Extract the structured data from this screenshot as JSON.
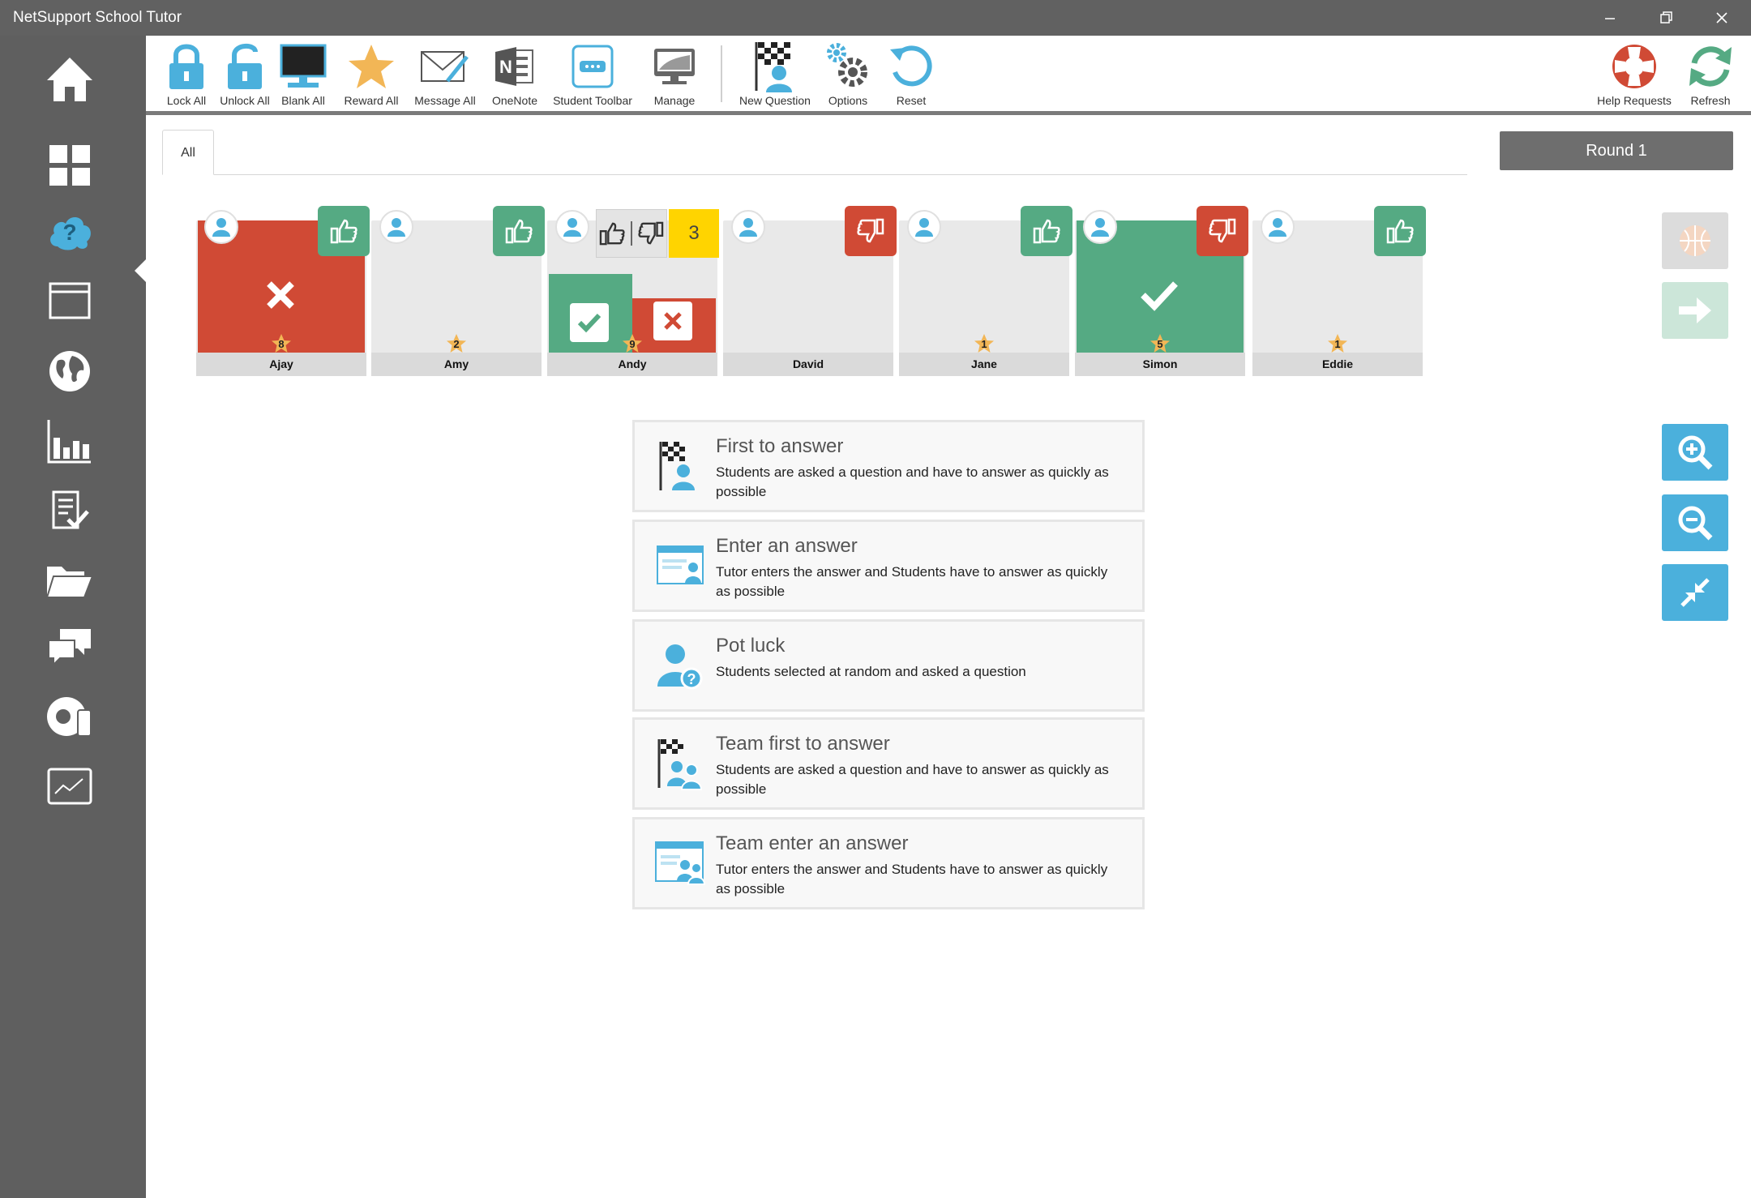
{
  "window": {
    "title": "NetSupport School Tutor"
  },
  "toolbar": {
    "items": [
      {
        "label": "Lock All",
        "icon": "lock-icon"
      },
      {
        "label": "Unlock All",
        "icon": "unlock-icon"
      },
      {
        "label": "Blank All",
        "icon": "monitor-icon"
      },
      {
        "label": "Reward All",
        "icon": "star-icon"
      },
      {
        "label": "Message All",
        "icon": "envelope-icon"
      },
      {
        "label": "OneNote",
        "icon": "onenote-icon"
      },
      {
        "label": "Student Toolbar",
        "icon": "toolbar-icon"
      },
      {
        "label": "Manage",
        "icon": "manage-icon"
      },
      {
        "label": "New Question",
        "icon": "checkered-flag-icon"
      },
      {
        "label": "Options",
        "icon": "gears-icon"
      },
      {
        "label": "Reset",
        "icon": "reset-icon"
      },
      {
        "label": "Help Requests",
        "icon": "lifebuoy-icon"
      },
      {
        "label": "Refresh",
        "icon": "refresh-icon"
      }
    ]
  },
  "tabs": [
    {
      "label": "All"
    }
  ],
  "round": {
    "label": "Round 1"
  },
  "students": [
    {
      "name": "Ajay",
      "score": "8",
      "state": "wrong",
      "vote": "up"
    },
    {
      "name": "Amy",
      "score": "2",
      "state": "none",
      "vote": "up"
    },
    {
      "name": "Andy",
      "score": "9",
      "state": "split",
      "vote": "both",
      "count": "3"
    },
    {
      "name": "David",
      "score": "",
      "state": "none",
      "vote": "down"
    },
    {
      "name": "Jane",
      "score": "1",
      "state": "none",
      "vote": "up"
    },
    {
      "name": "Simon",
      "score": "5",
      "state": "correct",
      "vote": "down"
    },
    {
      "name": "Eddie",
      "score": "1",
      "state": "none",
      "vote": "up"
    }
  ],
  "modes": [
    {
      "title": "First to answer",
      "desc": "Students are asked a question and have to answer as quickly as possible"
    },
    {
      "title": "Enter an answer",
      "desc": "Tutor enters the answer and Students have to answer as quickly as possible"
    },
    {
      "title": "Pot luck",
      "desc": "Students selected at random and asked a question"
    },
    {
      "title": "Team first to answer",
      "desc": "Students are asked a question and have to answer as quickly as possible"
    },
    {
      "title": "Team enter an answer",
      "desc": "Tutor enters the answer and Students have to answer as quickly as possible"
    }
  ],
  "colors": {
    "correct": "#55aa83",
    "wrong": "#d04a35",
    "accent": "#4bb0dc",
    "count": "#ffd400",
    "sidebar": "#5f5f5f"
  }
}
